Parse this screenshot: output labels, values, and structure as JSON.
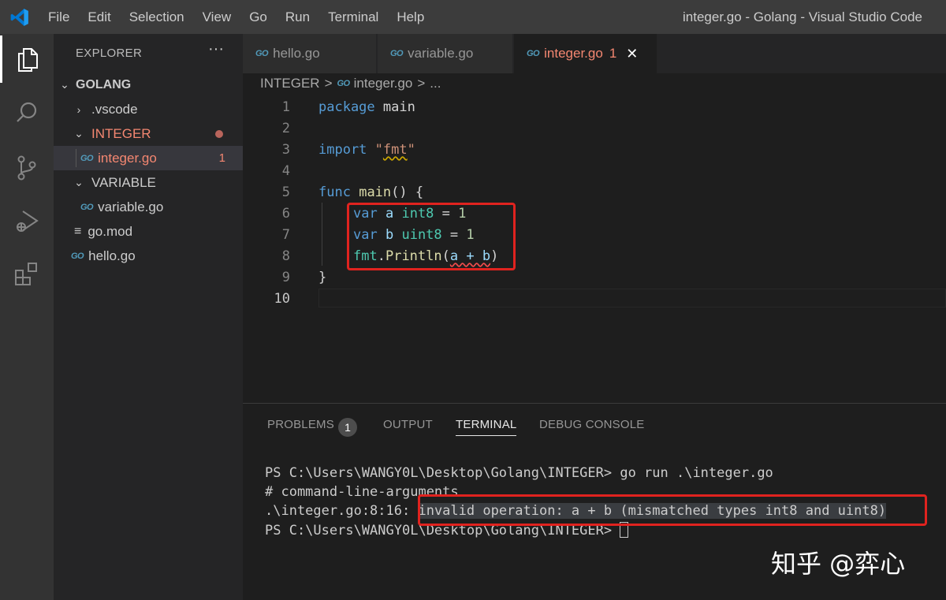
{
  "menu": [
    "File",
    "Edit",
    "Selection",
    "View",
    "Go",
    "Run",
    "Terminal",
    "Help"
  ],
  "window_title": "integer.go - Golang - Visual Studio Code",
  "activity_icons": [
    "explorer-icon",
    "search-icon",
    "source-control-icon",
    "run-debug-icon",
    "extensions-icon"
  ],
  "sidebar": {
    "header": "EXPLORER",
    "more": "···",
    "root": "GOLANG",
    "items": [
      {
        "label": ".vscode",
        "chevron": "›"
      },
      {
        "label": "INTEGER",
        "chevron": "⌄"
      },
      {
        "label": "integer.go",
        "badge": "1",
        "icon": "GO"
      },
      {
        "label": "VARIABLE",
        "chevron": "⌄"
      },
      {
        "label": "variable.go",
        "icon": "GO"
      },
      {
        "label": "go.mod",
        "icon": "≡"
      },
      {
        "label": "hello.go",
        "icon": "GO"
      }
    ]
  },
  "tabs": [
    {
      "label": "hello.go",
      "icon": "GO"
    },
    {
      "label": "variable.go",
      "icon": "GO"
    },
    {
      "label": "integer.go",
      "icon": "GO",
      "badge": "1",
      "close": "✕"
    }
  ],
  "breadcrumb": {
    "folder": "INTEGER",
    "sep": ">",
    "file": "integer.go",
    "more": "..."
  },
  "editor": {
    "line_numbers": [
      "1",
      "2",
      "3",
      "4",
      "5",
      "6",
      "7",
      "8",
      "9",
      "10"
    ],
    "lines": {
      "l1": {
        "kw": "package",
        "rest": " main"
      },
      "l3": {
        "kw": "import",
        "sp": " ",
        "q1": "\"",
        "str": "fmt",
        "q2": "\""
      },
      "l5": {
        "kw": "func",
        "sp": " ",
        "fn": "main",
        "rest": "() {"
      },
      "l6": {
        "kw": "var",
        "sp": " ",
        "v": "a",
        "sp2": " ",
        "ty": "int8",
        "eq": " = ",
        "num": "1"
      },
      "l7": {
        "kw": "var",
        "sp": " ",
        "v": "b",
        "sp2": " ",
        "ty": "uint8",
        "eq": " = ",
        "num": "1"
      },
      "l8": {
        "pkg": "fmt",
        "dot": ".",
        "fn": "Println",
        "open": "(",
        "expr": "a + b",
        "close": ")"
      },
      "l9": {
        "rest": "}"
      }
    }
  },
  "panel": {
    "tabs": [
      "PROBLEMS",
      "OUTPUT",
      "TERMINAL",
      "DEBUG CONSOLE"
    ],
    "problems_count": "1",
    "terminal": {
      "line1": "PS C:\\Users\\WANGY0L\\Desktop\\Golang\\INTEGER> go run .\\integer.go",
      "line2": "# command-line-arguments",
      "line3_prefix": ".\\integer.go:8:16: ",
      "line3_error": "invalid operation: a + b (mismatched types int8 and uint8)",
      "line4": "PS C:\\Users\\WANGY0L\\Desktop\\Golang\\INTEGER> "
    }
  },
  "watermark": "知乎 @弈心",
  "colors": {
    "error_box": "#e0231f",
    "tab_active_text": "#f48771",
    "keyword": "#569cd6",
    "type": "#4ec9b0"
  }
}
